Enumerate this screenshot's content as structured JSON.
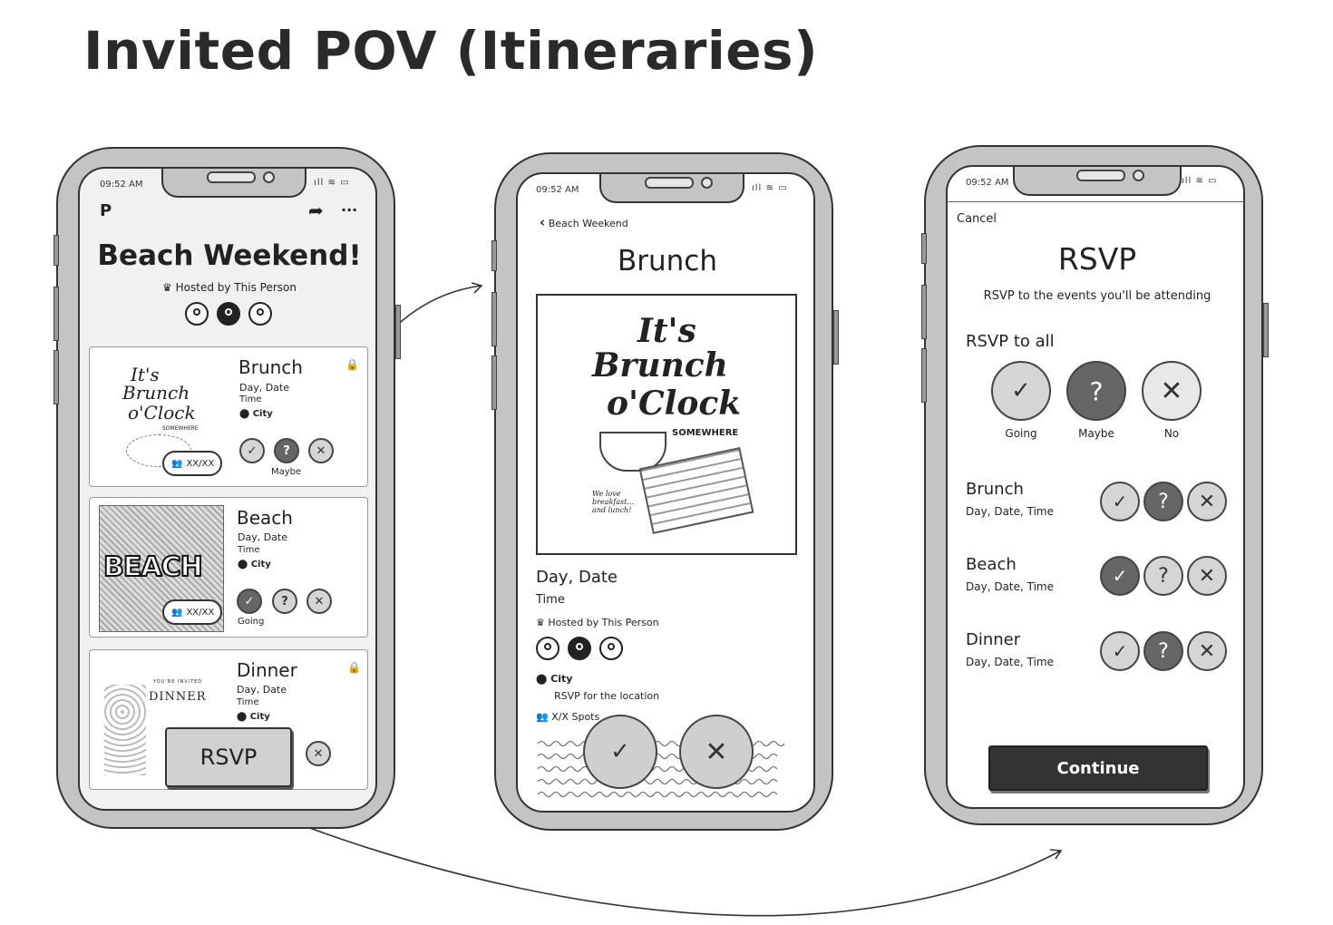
{
  "page_title": "Invited POV (Itineraries)",
  "status_time": "09:52 AM",
  "phone1": {
    "event_title": "Beach Weekend!",
    "hosted_by": "Hosted by This Person",
    "cards": [
      {
        "name": "Brunch",
        "date": "Day, Date",
        "time": "Time",
        "city": "City",
        "spots": "XX/XX",
        "status_label": "Maybe"
      },
      {
        "name": "Beach",
        "date": "Day, Date",
        "time": "Time",
        "city": "City",
        "spots": "XX/XX",
        "status_label": "Going"
      },
      {
        "name": "Dinner",
        "date": "Day, Date",
        "time": "Time",
        "city": "City"
      }
    ],
    "rsvp_button": "RSVP",
    "brunch_art": [
      "It's",
      "Brunch",
      "o'Clock",
      "SOMEWHERE"
    ],
    "dinner_art": [
      "YOU'RE INVITED",
      "DINNER"
    ],
    "beach_art": "BEACH"
  },
  "phone2": {
    "back_label": "Beach Weekend",
    "title": "Brunch",
    "art": [
      "It's",
      "Brunch",
      "o'Clock",
      "SOMEWHERE",
      "We love breakfast... and lunch!"
    ],
    "date": "Day, Date",
    "time": "Time",
    "hosted_by": "Hosted by This Person",
    "city": "City",
    "rsvp_location": "RSVP for the location",
    "spots": "X/X Spots"
  },
  "phone3": {
    "cancel": "Cancel",
    "title": "RSVP",
    "subtitle": "RSVP to the events you'll be attending",
    "rsvp_all": "RSVP to all",
    "options": [
      "Going",
      "Maybe",
      "No"
    ],
    "events": [
      {
        "name": "Brunch",
        "datetime": "Day, Date, Time",
        "selected": "maybe"
      },
      {
        "name": "Beach",
        "datetime": "Day, Date, Time",
        "selected": "going"
      },
      {
        "name": "Dinner",
        "datetime": "Day, Date, Time",
        "selected": "maybe"
      }
    ],
    "continue": "Continue"
  },
  "colors": {
    "selected": "#666666",
    "unselected": "#d5d5d5",
    "phone_frame": "#c4c4c4",
    "continue_bg": "#333333"
  },
  "icons": [
    "crown-icon",
    "location-pin-icon",
    "people-icon",
    "lock-icon",
    "share-icon",
    "more-icon",
    "back-chevron-icon",
    "check-icon",
    "question-icon",
    "x-icon",
    "app-logo-icon"
  ]
}
